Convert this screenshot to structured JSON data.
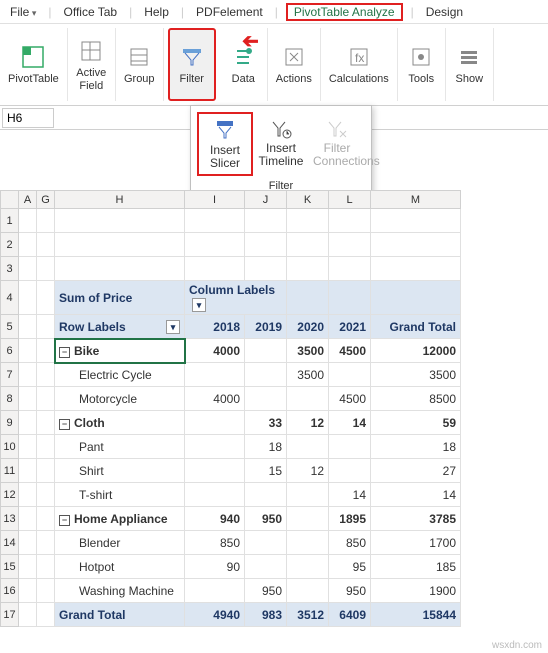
{
  "menu": {
    "file": "File",
    "office": "Office Tab",
    "help": "Help",
    "pdfe": "PDFelement",
    "pta": "PivotTable Analyze",
    "design": "Design"
  },
  "ribbon": {
    "pivottable": "PivotTable",
    "activefield": "Active\nField",
    "group": "Group",
    "filter": "Filter",
    "data": "Data",
    "actions": "Actions",
    "calculations": "Calculations",
    "tools": "Tools",
    "show": "Show"
  },
  "namebox": "H6",
  "filter_dd": {
    "insert_slicer": "Insert\nSlicer",
    "insert_timeline": "Insert\nTimeline",
    "filter_conn": "Filter\nConnections",
    "group": "Filter"
  },
  "cols": {
    "A": "A",
    "G": "G",
    "H": "H",
    "I": "I",
    "J": "J",
    "K": "K",
    "L": "L",
    "M": "M"
  },
  "rows": [
    "1",
    "2",
    "3",
    "4",
    "5",
    "6",
    "7",
    "8",
    "9",
    "10",
    "11",
    "12",
    "13",
    "14",
    "15",
    "16",
    "17"
  ],
  "pivot": {
    "sum": "Sum of Price",
    "collabel": "Column Labels",
    "rowlabel": "Row Labels",
    "y2018": "2018",
    "y2019": "2019",
    "y2020": "2020",
    "y2021": "2021",
    "gt": "Grand Total",
    "bike": "Bike",
    "ec": "Electric Cycle",
    "mc": "Motorcycle",
    "cloth": "Cloth",
    "pant": "Pant",
    "shirt": "Shirt",
    "tshirt": "T-shirt",
    "ha": "Home Appliance",
    "blender": "Blender",
    "hotpot": "Hotpot",
    "wm": "Washing Machine",
    "grandtotal": "Grand Total"
  },
  "chart_data": {
    "type": "table",
    "title": "Sum of Price",
    "columns": [
      "Row Labels",
      "2018",
      "2019",
      "2020",
      "2021",
      "Grand Total"
    ],
    "rows": [
      {
        "label": "Bike",
        "values": [
          4000,
          null,
          3500,
          4500,
          12000
        ],
        "group": true
      },
      {
        "label": "Electric Cycle",
        "values": [
          null,
          null,
          3500,
          null,
          3500
        ]
      },
      {
        "label": "Motorcycle",
        "values": [
          4000,
          null,
          null,
          4500,
          8500
        ]
      },
      {
        "label": "Cloth",
        "values": [
          null,
          33,
          12,
          14,
          59
        ],
        "group": true
      },
      {
        "label": "Pant",
        "values": [
          null,
          18,
          null,
          null,
          18
        ]
      },
      {
        "label": "Shirt",
        "values": [
          null,
          15,
          12,
          null,
          27
        ]
      },
      {
        "label": "T-shirt",
        "values": [
          null,
          null,
          null,
          14,
          14
        ]
      },
      {
        "label": "Home Appliance",
        "values": [
          940,
          950,
          null,
          1895,
          3785
        ],
        "group": true
      },
      {
        "label": "Blender",
        "values": [
          850,
          null,
          null,
          850,
          1700
        ]
      },
      {
        "label": "Hotpot",
        "values": [
          90,
          null,
          null,
          95,
          185
        ]
      },
      {
        "label": "Washing Machine",
        "values": [
          null,
          950,
          null,
          950,
          1900
        ]
      },
      {
        "label": "Grand Total",
        "values": [
          4940,
          983,
          3512,
          6409,
          15844
        ],
        "group": true
      }
    ]
  },
  "watermark": "wsxdn.com"
}
